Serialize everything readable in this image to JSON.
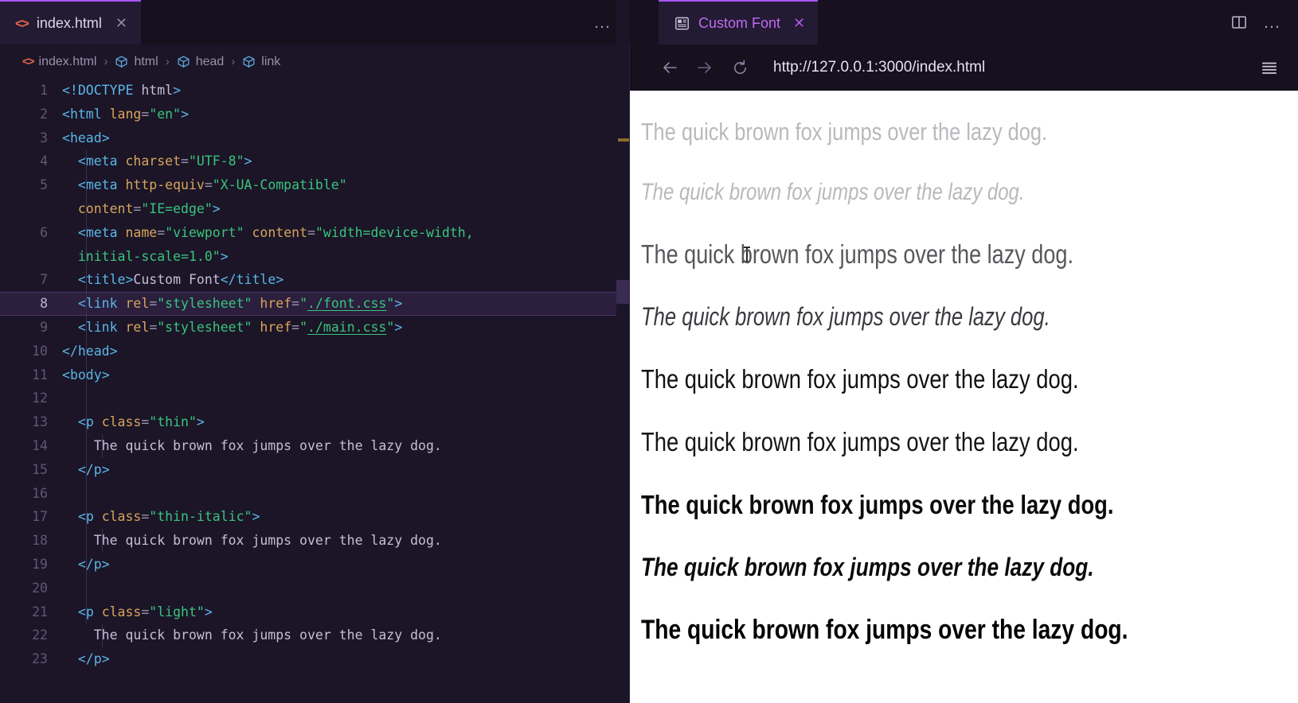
{
  "editor": {
    "tab": {
      "filename": "index.html",
      "icon": "html-file-icon",
      "close": "✕"
    },
    "tabbar_more": "…",
    "breadcrumb": {
      "separator": "›",
      "items": [
        {
          "label": "index.html",
          "icon": "html-file-icon"
        },
        {
          "label": "html",
          "icon": "symbol-cube-icon"
        },
        {
          "label": "head",
          "icon": "symbol-cube-icon"
        },
        {
          "label": "link",
          "icon": "symbol-cube-icon"
        }
      ]
    },
    "active_line": 8,
    "lines": [
      {
        "num": "1",
        "indent": 0,
        "tokens": [
          {
            "t": "doctype",
            "v": "<!DOCTYPE "
          },
          {
            "t": "text",
            "v": "html"
          },
          {
            "t": "punct",
            "v": ">"
          }
        ]
      },
      {
        "num": "2",
        "indent": 0,
        "tokens": [
          {
            "t": "punct",
            "v": "<"
          },
          {
            "t": "tag",
            "v": "html"
          },
          {
            "t": "text",
            "v": " "
          },
          {
            "t": "attr",
            "v": "lang"
          },
          {
            "t": "eq",
            "v": "="
          },
          {
            "t": "str",
            "v": "\"en\""
          },
          {
            "t": "punct",
            "v": ">"
          }
        ]
      },
      {
        "num": "3",
        "indent": 0,
        "tokens": [
          {
            "t": "punct",
            "v": "<"
          },
          {
            "t": "tag",
            "v": "head"
          },
          {
            "t": "punct",
            "v": ">"
          }
        ]
      },
      {
        "num": "4",
        "indent": 1,
        "tokens": [
          {
            "t": "punct",
            "v": "<"
          },
          {
            "t": "tag",
            "v": "meta"
          },
          {
            "t": "text",
            "v": " "
          },
          {
            "t": "attr",
            "v": "charset"
          },
          {
            "t": "eq",
            "v": "="
          },
          {
            "t": "str",
            "v": "\"UTF-8\""
          },
          {
            "t": "punct",
            "v": ">"
          }
        ]
      },
      {
        "num": "5",
        "indent": 1,
        "tokens": [
          {
            "t": "punct",
            "v": "<"
          },
          {
            "t": "tag",
            "v": "meta"
          },
          {
            "t": "text",
            "v": " "
          },
          {
            "t": "attr",
            "v": "http-equiv"
          },
          {
            "t": "eq",
            "v": "="
          },
          {
            "t": "str",
            "v": "\"X-UA-Compatible\""
          }
        ]
      },
      {
        "num": "",
        "indent": 1,
        "tokens": [
          {
            "t": "attr",
            "v": "content"
          },
          {
            "t": "eq",
            "v": "="
          },
          {
            "t": "str",
            "v": "\"IE=edge\""
          },
          {
            "t": "punct",
            "v": ">"
          }
        ]
      },
      {
        "num": "6",
        "indent": 1,
        "tokens": [
          {
            "t": "punct",
            "v": "<"
          },
          {
            "t": "tag",
            "v": "meta"
          },
          {
            "t": "text",
            "v": " "
          },
          {
            "t": "attr",
            "v": "name"
          },
          {
            "t": "eq",
            "v": "="
          },
          {
            "t": "str",
            "v": "\"viewport\""
          },
          {
            "t": "text",
            "v": " "
          },
          {
            "t": "attr",
            "v": "content"
          },
          {
            "t": "eq",
            "v": "="
          },
          {
            "t": "str",
            "v": "\"width=device-width,"
          }
        ]
      },
      {
        "num": "",
        "indent": 1,
        "tokens": [
          {
            "t": "str",
            "v": "initial-scale=1.0\""
          },
          {
            "t": "punct",
            "v": ">"
          }
        ]
      },
      {
        "num": "7",
        "indent": 1,
        "tokens": [
          {
            "t": "punct",
            "v": "<"
          },
          {
            "t": "tag",
            "v": "title"
          },
          {
            "t": "punct",
            "v": ">"
          },
          {
            "t": "title",
            "v": "Custom Font"
          },
          {
            "t": "punct",
            "v": "</"
          },
          {
            "t": "tag",
            "v": "title"
          },
          {
            "t": "punct",
            "v": ">"
          }
        ]
      },
      {
        "num": "8",
        "indent": 1,
        "tokens": [
          {
            "t": "punct",
            "v": "<"
          },
          {
            "t": "tag",
            "v": "link"
          },
          {
            "t": "text",
            "v": " "
          },
          {
            "t": "attr",
            "v": "rel"
          },
          {
            "t": "eq",
            "v": "="
          },
          {
            "t": "str",
            "v": "\"stylesheet\""
          },
          {
            "t": "text",
            "v": " "
          },
          {
            "t": "attr",
            "v": "href"
          },
          {
            "t": "eq",
            "v": "="
          },
          {
            "t": "str",
            "v": "\""
          },
          {
            "t": "link",
            "v": "./font.css"
          },
          {
            "t": "str",
            "v": "\""
          },
          {
            "t": "punct",
            "v": ">"
          }
        ]
      },
      {
        "num": "9",
        "indent": 1,
        "tokens": [
          {
            "t": "punct",
            "v": "<"
          },
          {
            "t": "tag",
            "v": "link"
          },
          {
            "t": "text",
            "v": " "
          },
          {
            "t": "attr",
            "v": "rel"
          },
          {
            "t": "eq",
            "v": "="
          },
          {
            "t": "str",
            "v": "\"stylesheet\""
          },
          {
            "t": "text",
            "v": " "
          },
          {
            "t": "attr",
            "v": "href"
          },
          {
            "t": "eq",
            "v": "="
          },
          {
            "t": "str",
            "v": "\""
          },
          {
            "t": "link",
            "v": "./main.css"
          },
          {
            "t": "str",
            "v": "\""
          },
          {
            "t": "punct",
            "v": ">"
          }
        ]
      },
      {
        "num": "10",
        "indent": 0,
        "tokens": [
          {
            "t": "punct",
            "v": "</"
          },
          {
            "t": "tag",
            "v": "head"
          },
          {
            "t": "punct",
            "v": ">"
          }
        ]
      },
      {
        "num": "11",
        "indent": 0,
        "tokens": [
          {
            "t": "punct",
            "v": "<"
          },
          {
            "t": "tag",
            "v": "body"
          },
          {
            "t": "punct",
            "v": ">"
          }
        ]
      },
      {
        "num": "12",
        "indent": 0,
        "tokens": []
      },
      {
        "num": "13",
        "indent": 1,
        "tokens": [
          {
            "t": "punct",
            "v": "<"
          },
          {
            "t": "tag",
            "v": "p"
          },
          {
            "t": "text",
            "v": " "
          },
          {
            "t": "attr",
            "v": "class"
          },
          {
            "t": "eq",
            "v": "="
          },
          {
            "t": "str",
            "v": "\"thin\""
          },
          {
            "t": "punct",
            "v": ">"
          }
        ]
      },
      {
        "num": "14",
        "indent": 2,
        "tokens": [
          {
            "t": "text",
            "v": "The quick brown fox jumps over the lazy dog."
          }
        ]
      },
      {
        "num": "15",
        "indent": 1,
        "tokens": [
          {
            "t": "punct",
            "v": "</"
          },
          {
            "t": "tag",
            "v": "p"
          },
          {
            "t": "punct",
            "v": ">"
          }
        ]
      },
      {
        "num": "16",
        "indent": 0,
        "tokens": []
      },
      {
        "num": "17",
        "indent": 1,
        "tokens": [
          {
            "t": "punct",
            "v": "<"
          },
          {
            "t": "tag",
            "v": "p"
          },
          {
            "t": "text",
            "v": " "
          },
          {
            "t": "attr",
            "v": "class"
          },
          {
            "t": "eq",
            "v": "="
          },
          {
            "t": "str",
            "v": "\"thin-italic\""
          },
          {
            "t": "punct",
            "v": ">"
          }
        ]
      },
      {
        "num": "18",
        "indent": 2,
        "tokens": [
          {
            "t": "text",
            "v": "The quick brown fox jumps over the lazy dog."
          }
        ]
      },
      {
        "num": "19",
        "indent": 1,
        "tokens": [
          {
            "t": "punct",
            "v": "</"
          },
          {
            "t": "tag",
            "v": "p"
          },
          {
            "t": "punct",
            "v": ">"
          }
        ]
      },
      {
        "num": "20",
        "indent": 0,
        "tokens": []
      },
      {
        "num": "21",
        "indent": 1,
        "tokens": [
          {
            "t": "punct",
            "v": "<"
          },
          {
            "t": "tag",
            "v": "p"
          },
          {
            "t": "text",
            "v": " "
          },
          {
            "t": "attr",
            "v": "class"
          },
          {
            "t": "eq",
            "v": "="
          },
          {
            "t": "str",
            "v": "\"light\""
          },
          {
            "t": "punct",
            "v": ">"
          }
        ]
      },
      {
        "num": "22",
        "indent": 2,
        "tokens": [
          {
            "t": "text",
            "v": "The quick brown fox jumps over the lazy dog."
          }
        ]
      },
      {
        "num": "23",
        "indent": 1,
        "tokens": [
          {
            "t": "punct",
            "v": "</"
          },
          {
            "t": "tag",
            "v": "p"
          },
          {
            "t": "punct",
            "v": ">"
          }
        ]
      }
    ]
  },
  "browser": {
    "tab": {
      "title": "Custom Font",
      "icon": "preview-page-icon",
      "close": "✕"
    },
    "split_icon": "split-editor-icon",
    "more": "…",
    "nav": {
      "back": "back-arrow-icon",
      "forward": "forward-arrow-icon",
      "reload": "reload-icon",
      "menu": "hamburger-menu-icon"
    },
    "url": "http://127.0.0.1:3000/index.html",
    "samples": [
      {
        "cls": "s-thin",
        "text": "The quick brown fox jumps over the lazy dog."
      },
      {
        "cls": "s-thin-italic",
        "text": "The quick brown fox jumps over the lazy dog."
      },
      {
        "cls": "s-light",
        "text": "The quick brown fox jumps over the lazy dog."
      },
      {
        "cls": "s-light-ital",
        "text": "The quick brown fox jumps over the lazy dog."
      },
      {
        "cls": "s-regular",
        "text": "The quick brown fox jumps over the lazy dog."
      },
      {
        "cls": "s-medium",
        "text": "The quick brown fox jumps over the lazy dog."
      },
      {
        "cls": "s-semibold",
        "text": "The quick brown fox jumps over the lazy dog."
      },
      {
        "cls": "s-bold-italic",
        "text": "The quick brown fox jumps over the lazy dog."
      },
      {
        "cls": "s-bold",
        "text": "The quick brown fox jumps over the lazy dog."
      }
    ]
  },
  "colors": {
    "accent_purple": "#a855f7",
    "editor_bg": "#1b1527",
    "tabbar_bg": "#16101f",
    "active_line": "#2b1f3d",
    "tag_blue": "#5bb6e8",
    "attr_orange": "#d9a45b",
    "string_green": "#39c47e",
    "file_icon_orange": "#e2644a",
    "ruler_mark": "#8a6b2e"
  }
}
